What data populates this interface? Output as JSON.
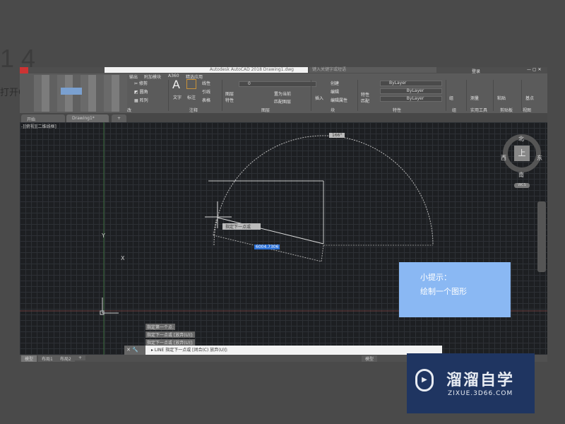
{
  "overlay": {
    "step": "1 4",
    "side_text": "打开C"
  },
  "window": {
    "title": "Autodesk AutoCAD 2018  Drawing1.dwg",
    "search_placeholder": "键入关键字或短语",
    "user": "登录"
  },
  "ribbon": {
    "menu_tabs": [
      "输出",
      "附加模块",
      "A360",
      "精选应用"
    ],
    "modify": [
      "修剪",
      "圆角",
      "阵列"
    ],
    "annotation": {
      "text": "文字",
      "dim": "标注",
      "items": [
        "线性",
        "引线",
        "表格"
      ]
    },
    "layers": {
      "props": "图层特性",
      "current": "0",
      "items": [
        "置为当前",
        "匹配图层"
      ]
    },
    "block": {
      "insert": "插入",
      "items": [
        "创建",
        "编辑",
        "编辑属性"
      ]
    },
    "properties": {
      "match": "特性匹配",
      "values": [
        "ByLayer",
        "ByLayer",
        "ByLayer"
      ]
    },
    "group": "组",
    "utilities": "测量",
    "clipboard": "粘贴",
    "view": "基点",
    "panel_labels": [
      "改",
      "注释",
      "图层",
      "块",
      "特性",
      "组",
      "实用工具",
      "剪贴板",
      "视图"
    ]
  },
  "tabs": [
    "开始",
    "Drawing1*",
    "+"
  ],
  "viewport": {
    "label": "-][俯视][二维线框]",
    "angle": "166°",
    "prompt": "指定下一点或",
    "input_value": "6004.7306",
    "axis_x": "X",
    "axis_y": "Y"
  },
  "viewcube": {
    "north": "北",
    "south": "南",
    "east": "东",
    "west": "西",
    "top": "上",
    "wcs": "WCS"
  },
  "command": {
    "history": [
      "指定第一个点:",
      "指定下一点或 [放弃(U)]:",
      "指定下一点或 [放弃(U)]:"
    ],
    "line": "LINE 指定下一点或 [闭合(C) 放弃(U)]:"
  },
  "layout_tabs": [
    "模型",
    "布局1",
    "布局2",
    "+"
  ],
  "status": {
    "model": "模型"
  },
  "tip": {
    "title": "小提示：",
    "body": "绘制一个图形"
  },
  "watermark": {
    "name": "溜溜自学",
    "url": "ZIXUE.3D66.COM"
  }
}
